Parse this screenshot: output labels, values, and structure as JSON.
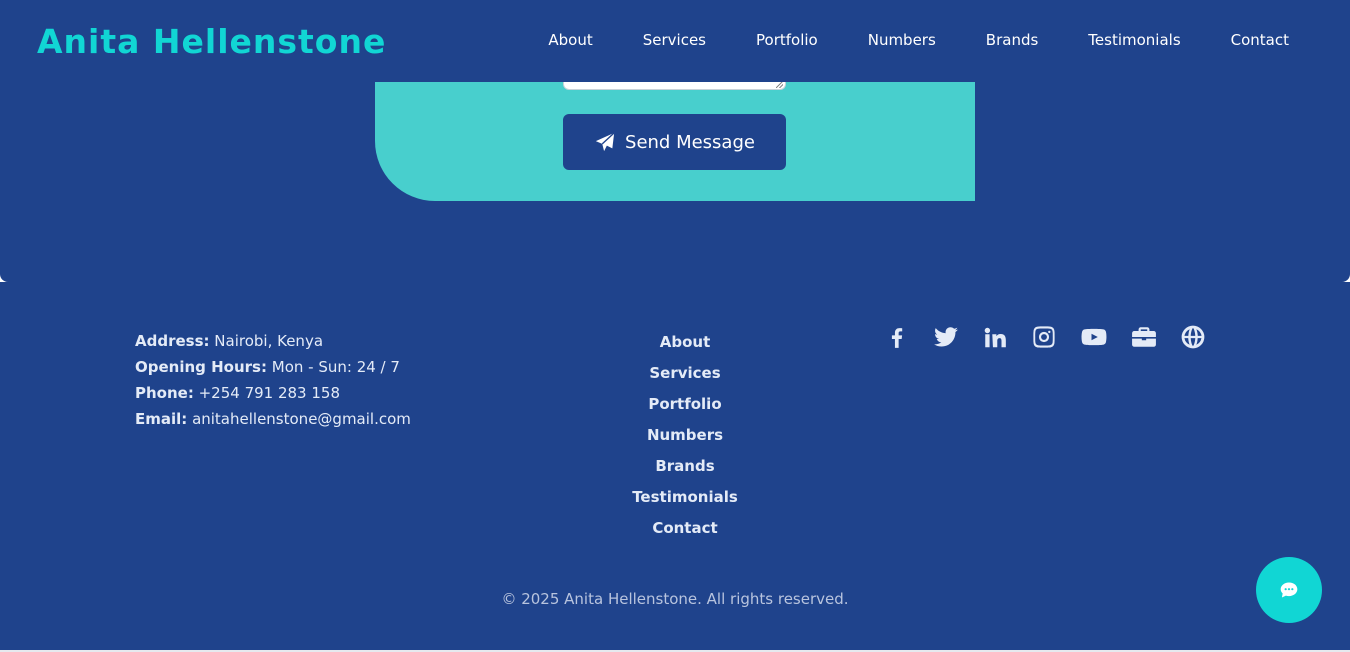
{
  "brand": {
    "name": "Anita Hellenstone"
  },
  "nav": {
    "items": [
      "About",
      "Services",
      "Portfolio",
      "Numbers",
      "Brands",
      "Testimonials",
      "Contact"
    ]
  },
  "form": {
    "send_label": "Send Message",
    "send_icon": "paper-plane-icon"
  },
  "footer": {
    "contact": [
      {
        "label": "Address:",
        "value": "Nairobi, Kenya"
      },
      {
        "label": "Opening Hours:",
        "value": "Mon - Sun: 24 / 7"
      },
      {
        "label": "Phone:",
        "value": "+254 791 283 158"
      },
      {
        "label": "Email:",
        "value": "anitahellenstone@gmail.com"
      }
    ],
    "links": [
      "About",
      "Services",
      "Portfolio",
      "Numbers",
      "Brands",
      "Testimonials",
      "Contact"
    ],
    "socials": [
      "facebook-icon",
      "twitter-icon",
      "linkedin-icon",
      "instagram-icon",
      "youtube-icon",
      "briefcase-icon",
      "globe-icon"
    ],
    "copyright": "© 2025 Anita Hellenstone. All rights reserved."
  },
  "chat": {
    "icon": "chat-icon"
  },
  "colors": {
    "primary": "#1f438c",
    "accent": "#11d6d4",
    "card": "#48cfcd",
    "text_light": "#e4ebf7"
  }
}
